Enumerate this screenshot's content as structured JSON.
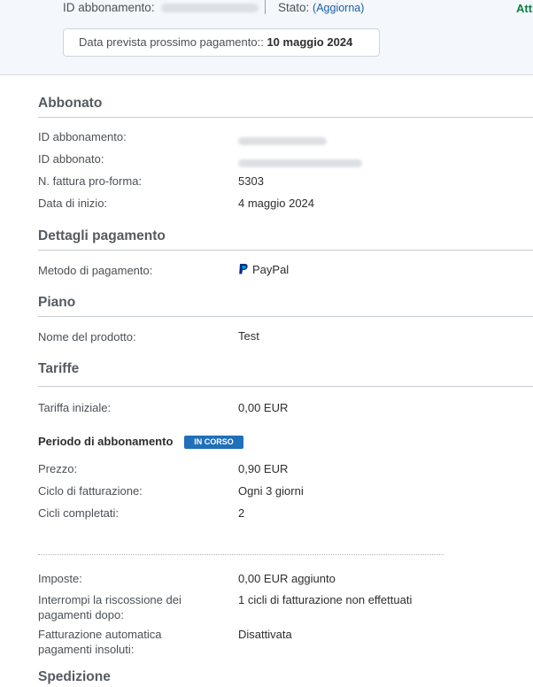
{
  "header": {
    "id_label": "ID abbonamento:",
    "status_label": "Stato:",
    "status_value": "Attivo",
    "refresh_link": "(Aggiorna)",
    "next_payment_label": "Data prevista prossimo pagamento::",
    "next_payment_value": "10 maggio 2024"
  },
  "abbonato": {
    "title": "Abbonato",
    "id_label": "ID abbonamento:",
    "subscriber_label": "ID abbonato:",
    "invoice_label": "N. fattura pro-forma:",
    "invoice_value": "5303",
    "start_label": "Data di inizio:",
    "start_value": "4 maggio 2024"
  },
  "pagamento": {
    "title": "Dettagli pagamento",
    "method_label": "Metodo di pagamento:",
    "method_value": "PayPal"
  },
  "piano": {
    "title": "Piano",
    "product_label": "Nome del prodotto:",
    "product_value": "Test"
  },
  "tariffe": {
    "title": "Tariffe",
    "initial_label": "Tariffa iniziale:",
    "initial_value": "0,00 EUR",
    "period_title": "Periodo di abbonamento",
    "period_badge": "IN CORSO",
    "price_label": "Prezzo:",
    "price_value": "0,90 EUR",
    "cycle_label": "Ciclo di fatturazione:",
    "cycle_value": "Ogni 3 giorni",
    "completed_label": "Cicli completati:",
    "completed_value": "2",
    "tax_label": "Imposte:",
    "tax_value": "0,00 EUR aggiunto",
    "stop_label_1": "Interrompi la riscossione dei",
    "stop_label_2": "pagamenti dopo:",
    "stop_value": "1 cicli di fatturazione non effettuati",
    "auto_label_1": "Fatturazione automatica",
    "auto_label_2": "pagamenti insoluti:",
    "auto_value": "Disattivata"
  },
  "spedizione": {
    "title": "Spedizione"
  },
  "colors": {
    "status_active": "#0d7f3f",
    "link": "#1a5ea8",
    "badge": "#1f6fb9"
  },
  "icons": {
    "payment_method": "paypal-icon"
  }
}
